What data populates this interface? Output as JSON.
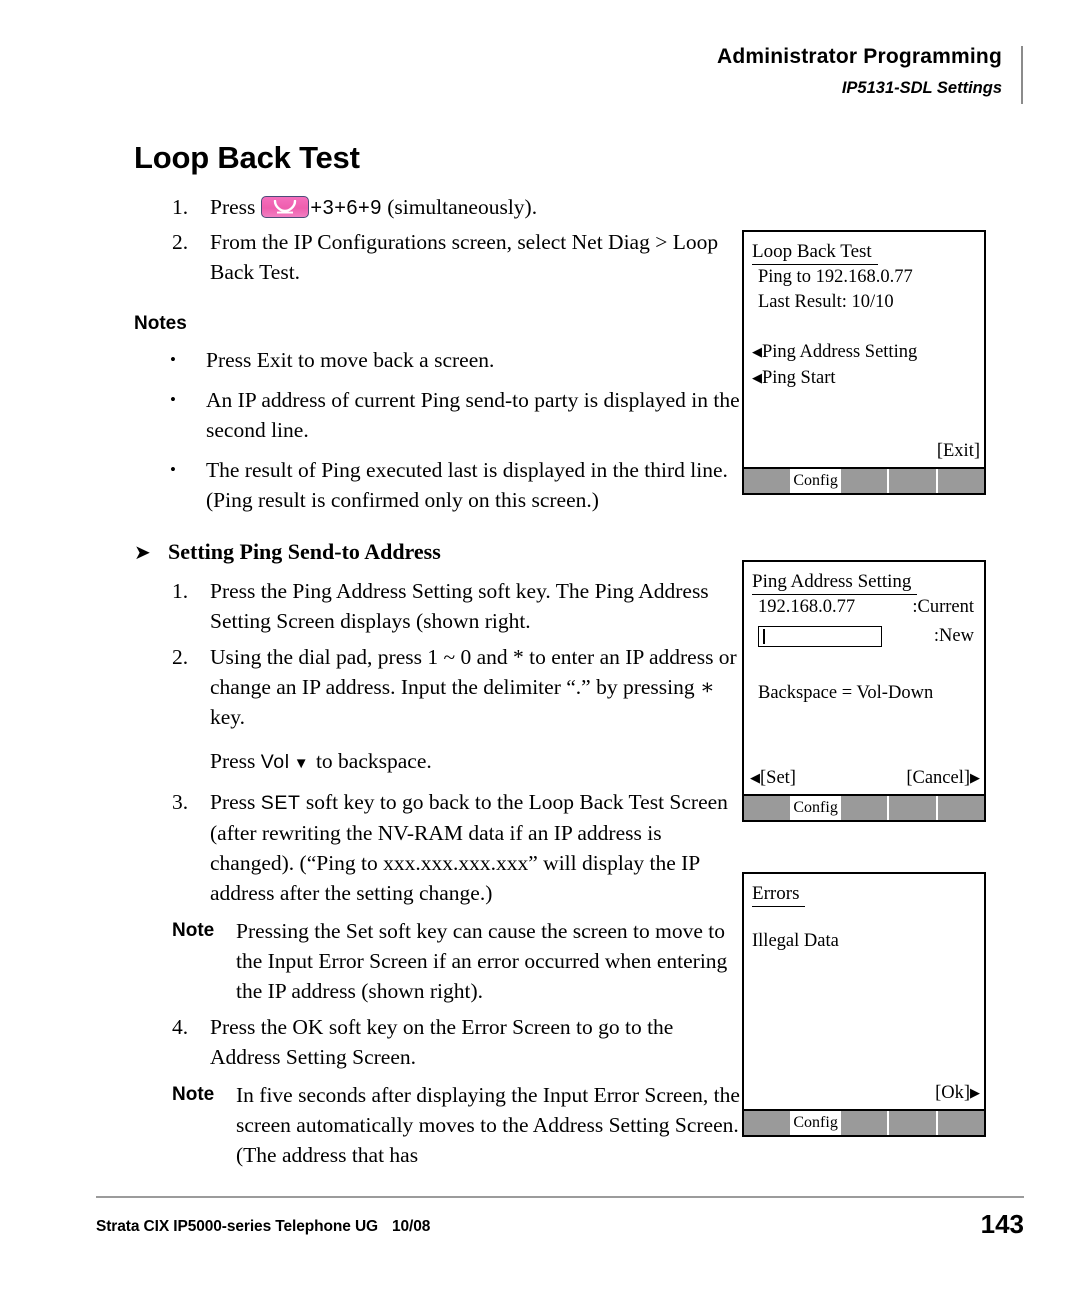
{
  "header": {
    "title": "Administrator Programming",
    "subtitle": "IP5131-SDL Settings"
  },
  "page_title": "Loop Back Test",
  "intro_steps": [
    {
      "num": "1.",
      "pre": "Press",
      "key_icon": "handset-hold-key-icon",
      "post": "+3+6+9 (simultaneously).",
      "post_keys": "+3+6+9",
      "post_tail": " (simultaneously)."
    },
    {
      "num": "2.",
      "text": "From the IP Configurations screen, select Net Diag > Loop Back Test."
    }
  ],
  "notes_heading": "Notes",
  "notes": [
    "Press Exit to move back a screen.",
    "An IP address of current Ping send-to party is displayed in the second line.",
    "The result of Ping executed last is displayed in the third line. (Ping result is confirmed only on this screen.)"
  ],
  "section": {
    "arrow": "➤",
    "heading": "Setting Ping Send-to Address",
    "steps": [
      {
        "num": "1.",
        "text": "Press the Ping Address Setting soft key. The Ping Address Setting Screen displays (shown right."
      },
      {
        "num": "2.",
        "text": "Using the dial pad, press 1 ~ 0 and * to enter an IP address or change an IP address. Input the delimiter “.” by pressing ∗  key."
      },
      {
        "num": "3.",
        "text_pre": "Press ",
        "keycap": "SET",
        "text_post": " soft key to go back to the Loop Back Test Screen (after rewriting the NV-RAM data if an IP address is changed). (“Ping to xxx.xxx.xxx.xxx” will display the IP address after the setting change.)"
      },
      {
        "num": "4.",
        "text": "Press the OK soft key on the Error Screen to go to the Address Setting Screen."
      }
    ],
    "backspace_para": {
      "pre": "Press ",
      "keycap": "Vol",
      "arrow": "▼",
      "post": " to backspace."
    },
    "notes_inline": [
      {
        "label": "Note",
        "text": "Pressing the Set soft key can cause the screen to move to the Input Error Screen if an error occurred when entering the IP address (shown right)."
      },
      {
        "label": "Note",
        "text": "In five seconds after displaying the Input Error Screen, the screen automatically moves to the Address Setting Screen. (The address that has"
      }
    ]
  },
  "lcd_screens": [
    {
      "id": "loopback",
      "title": "Loop Back Test ",
      "lines": [
        "Ping to 192.168.0.77",
        "Last Result: 10/10"
      ],
      "menu_items": [
        "Ping Address Setting",
        "Ping Start"
      ],
      "bottom_right": "[Exit]",
      "softkeys": [
        "",
        "Config",
        "",
        "",
        ""
      ],
      "active_softkey_index": 1
    },
    {
      "id": "ping-address-setting",
      "title": "Ping Address Setting",
      "current_value": "192.168.0.77",
      "current_label": ":Current",
      "new_value": "",
      "new_label": ":New",
      "hint": "Backspace = Vol-Down",
      "bottom_left": "[Set]",
      "bottom_right": "[Cancel]",
      "softkeys": [
        "",
        "Config",
        "",
        "",
        ""
      ],
      "active_softkey_index": 1
    },
    {
      "id": "errors",
      "title": "Errors",
      "lines": [
        "Illegal Data"
      ],
      "bottom_right": "[Ok]",
      "softkeys": [
        "",
        "Config",
        "",
        "",
        ""
      ],
      "active_softkey_index": 1
    }
  ],
  "footer": {
    "doc": "Strata CIX IP5000-series Telephone UG",
    "date": "10/08",
    "page": "143"
  },
  "colors": {
    "key_pink": "#f06cb4",
    "softkey_gray": "#9a9a9a",
    "rule_gray": "#9b9b9b"
  }
}
